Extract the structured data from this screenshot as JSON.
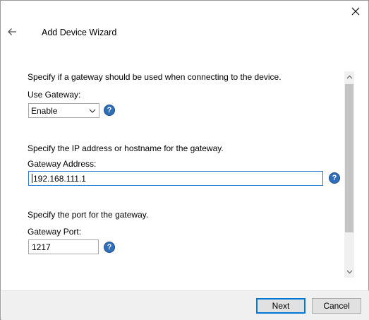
{
  "window": {
    "title": "Add Device Wizard"
  },
  "icons": {
    "back": "arrow-left-icon",
    "close": "close-icon",
    "help": "question-mark-icon"
  },
  "gateway_section": {
    "description": "Specify if a gateway should be used when connecting to the device.",
    "label": "Use Gateway:",
    "selected_value": "Enable"
  },
  "address_section": {
    "description": "Specify the IP address or hostname for the gateway.",
    "label": "Gateway Address:",
    "value": "192.168.111.1"
  },
  "port_section": {
    "description": "Specify the port for the gateway.",
    "label": "Gateway Port:",
    "value": "1217"
  },
  "help_glyph": "?",
  "footer": {
    "next_label": "Next",
    "cancel_label": "Cancel"
  },
  "colors": {
    "accent": "#0078d7",
    "help_icon": "#2e6fb8",
    "footer_bg": "#f0f0f0"
  }
}
